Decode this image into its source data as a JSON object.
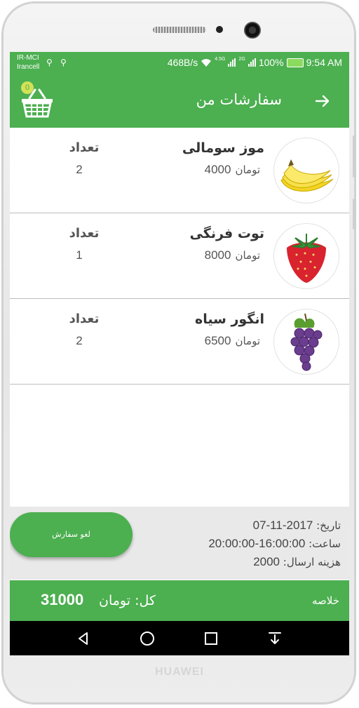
{
  "device": {
    "brand": "HUAWEI"
  },
  "status_bar": {
    "carrier_1": "IR-MCI",
    "carrier_2": "Irancell",
    "speed": "468B/s",
    "network": "4.5G",
    "network_2": "2G",
    "battery": "100%",
    "time": "9:54 AM",
    "icons": [
      "usb-icon",
      "usb-icon",
      "wifi-icon",
      "signal-icon",
      "battery-charging-icon"
    ]
  },
  "app_bar": {
    "title": "سفارشات من",
    "back_icon": "arrow-right-icon",
    "cart_icon": "basket-icon",
    "cart_count": "0"
  },
  "orders": [
    {
      "name": "موز سومالی",
      "currency": "تومان",
      "price": "4000",
      "qty_label": "تعداد",
      "qty": "2",
      "image": "banana"
    },
    {
      "name": "توت فرنگی",
      "currency": "تومان",
      "price": "8000",
      "qty_label": "تعداد",
      "qty": "1",
      "image": "strawberry"
    },
    {
      "name": "انگور سیاه",
      "currency": "تومان",
      "price": "6500",
      "qty_label": "تعداد",
      "qty": "2",
      "image": "grapes"
    }
  ],
  "details": {
    "date_label": "تاریخ:",
    "date": "07-11-2017",
    "time_label": "ساعت:",
    "time": "20:00:00-16:00:00",
    "shipping_label": "هزینه ارسال:",
    "shipping": "2000",
    "cancel_button": "لغو سفارش"
  },
  "summary": {
    "label": "خلاصه",
    "total_label": "کل: تومان",
    "total": "31000"
  },
  "nav": [
    "back-triangle-icon",
    "home-circle-icon",
    "recents-square-icon",
    "notification-pull-icon"
  ],
  "colors": {
    "accent": "#4caf50",
    "badge": "#d4e157"
  }
}
